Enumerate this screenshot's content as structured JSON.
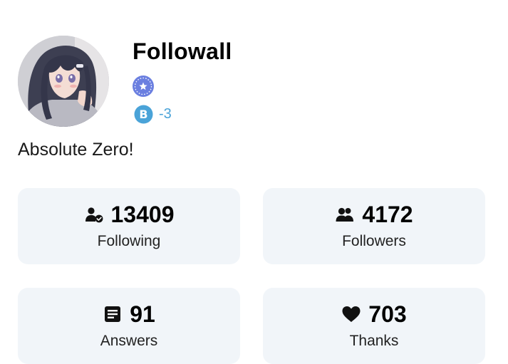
{
  "profile": {
    "username": "Followall",
    "points": "-3",
    "bio": "Absolute Zero!"
  },
  "stats": {
    "following": {
      "number": "13409",
      "label": "Following"
    },
    "followers": {
      "number": "4172",
      "label": "Followers"
    },
    "answers": {
      "number": "91",
      "label": "Answers"
    },
    "thanks": {
      "number": "703",
      "label": "Thanks"
    }
  },
  "icons": {
    "rank_badge": "rank-star-badge-icon",
    "points": "points-b-icon",
    "following": "user-check-icon",
    "followers": "users-icon",
    "answers": "document-lines-icon",
    "thanks": "heart-icon"
  },
  "colors": {
    "rank_badge": "#6b7fe0",
    "points": "#4aa3d8",
    "card_background": "#f1f5f9"
  }
}
